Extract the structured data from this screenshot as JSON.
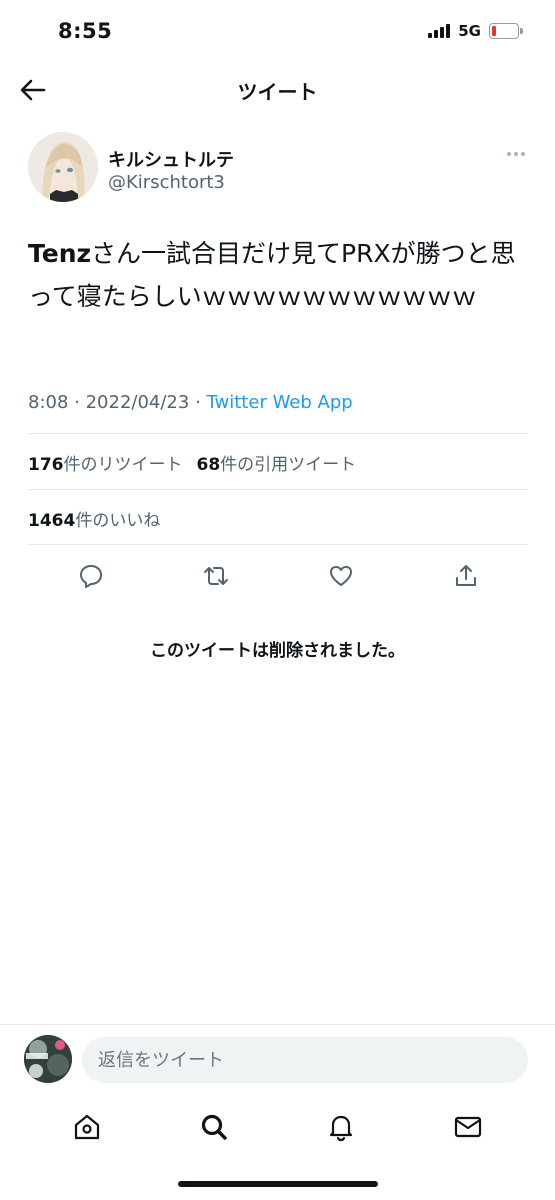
{
  "status_bar": {
    "time": "8:55",
    "network": "5G",
    "battery_level": 0.15,
    "battery_color": "#e5342e"
  },
  "header": {
    "title": "ツイート"
  },
  "author": {
    "display_name": "キルシュトルテ",
    "handle": "@Kirschtort3"
  },
  "tweet": {
    "text_bold": "Tenz",
    "text_rest": "さん一試合目だけ見てPRXが勝つと思って寝たらしいｗｗｗｗｗｗｗｗｗｗｗ",
    "time": "8:08",
    "separator": " · ",
    "date": "2022/04/23",
    "source": "Twitter Web App"
  },
  "stats": {
    "retweets_count": "176",
    "retweets_label": "件のリツイート",
    "quotes_count": "68",
    "quotes_label": "件の引用ツイート",
    "likes_count": "1464",
    "likes_label": "件のいいね"
  },
  "actions": [
    {
      "icon": "reply-icon"
    },
    {
      "icon": "retweet-icon"
    },
    {
      "icon": "like-icon"
    },
    {
      "icon": "share-icon"
    }
  ],
  "deleted_notice": "このツイートは削除されました。",
  "reply_bar": {
    "placeholder": "返信をツイート"
  },
  "tab_bar": [
    {
      "icon": "home-icon"
    },
    {
      "icon": "search-icon"
    },
    {
      "icon": "notifications-icon"
    },
    {
      "icon": "messages-icon"
    }
  ],
  "colors": {
    "accent": "#1d9bf0",
    "secondary_text": "#536471",
    "primary_text": "#0f1419"
  }
}
